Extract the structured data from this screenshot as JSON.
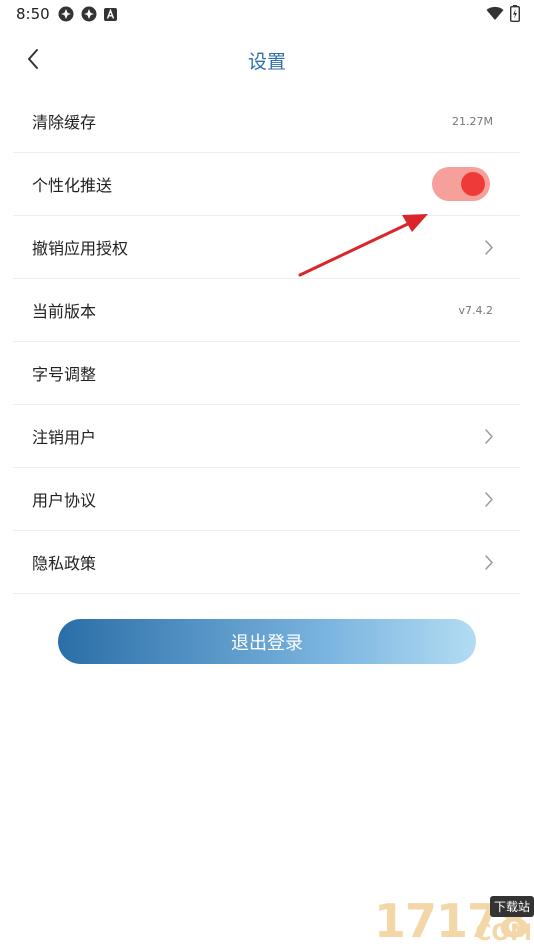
{
  "status_bar": {
    "time": "8:50"
  },
  "header": {
    "title": "设置"
  },
  "settings": {
    "clear_cache": {
      "label": "清除缓存",
      "value": "21.27M"
    },
    "push": {
      "label": "个性化推送",
      "enabled": true
    },
    "revoke": {
      "label": "撤销应用授权"
    },
    "version": {
      "label": "当前版本",
      "value": "v7.4.2"
    },
    "font_size": {
      "label": "字号调整"
    },
    "deregister": {
      "label": "注销用户"
    },
    "agreement": {
      "label": "用户协议"
    },
    "privacy": {
      "label": "隐私政策"
    }
  },
  "logout": {
    "label": "退出登录"
  },
  "watermark": {
    "digits": "17178",
    "badge": "下载站",
    "suffix": "COM"
  },
  "colors": {
    "accent": "#2f6fa6",
    "toggle_on": "#ef3b37",
    "toggle_track": "#f6a09b",
    "arrow": "#d9262b"
  }
}
